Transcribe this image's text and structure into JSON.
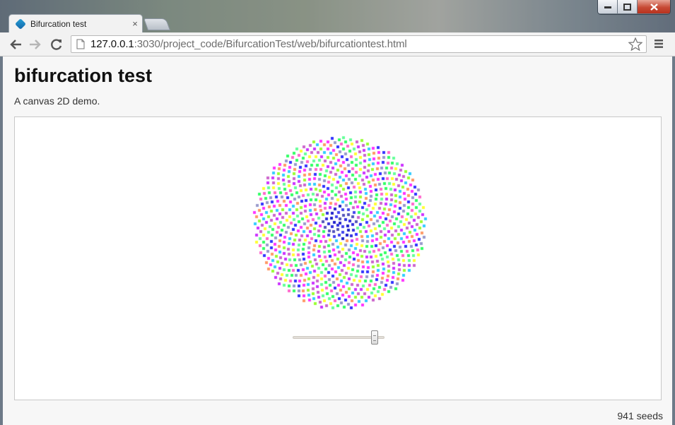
{
  "browser": {
    "tab_title": "Bifurcation test",
    "tab_close": "×",
    "url_host": "127.0.0.1",
    "url_rest": ":3030/project_code/BifurcationTest/web/bifurcationtest.html"
  },
  "page": {
    "heading": "bifurcation test",
    "subtitle": "A canvas 2D demo.",
    "seed_count_text": "941 seeds"
  },
  "slider": {
    "value_fraction": 0.9
  },
  "seeds": {
    "count": 941,
    "palette": [
      "#ff33ff",
      "#99ff33",
      "#cc33ff",
      "#ffff33",
      "#33ff66",
      "#3333ff",
      "#ff9966",
      "#33ccff",
      "#cc66cc",
      "#66ff99",
      "#ff66cc",
      "#9999cc"
    ]
  },
  "colors": {
    "accent": "#1a7fc6",
    "close_button": "#c74a35"
  }
}
